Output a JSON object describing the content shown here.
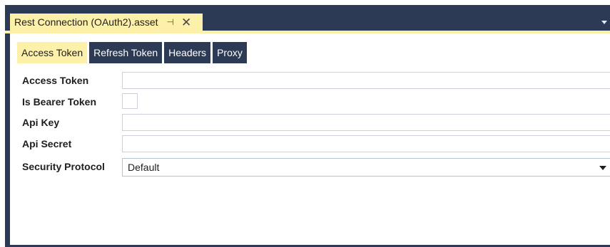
{
  "document_tab": {
    "title": "Rest Connection (OAuth2).asset",
    "pin_glyph": "⊣",
    "close_glyph": "✕"
  },
  "tabs": [
    {
      "label": "Access Token",
      "active": true
    },
    {
      "label": "Refresh Token",
      "active": false
    },
    {
      "label": "Headers",
      "active": false
    },
    {
      "label": "Proxy",
      "active": false
    }
  ],
  "form": {
    "access_token": {
      "label": "Access Token",
      "value": ""
    },
    "is_bearer_token": {
      "label": "Is Bearer Token",
      "checked": false
    },
    "api_key": {
      "label": "Api Key",
      "value": ""
    },
    "api_secret": {
      "label": "Api Secret",
      "value": ""
    },
    "security_protocol": {
      "label": "Security Protocol",
      "value": "Default"
    }
  },
  "colors": {
    "frame": "#2d3a56",
    "accent": "#fdf0a8",
    "border": "#ccd1dc"
  }
}
